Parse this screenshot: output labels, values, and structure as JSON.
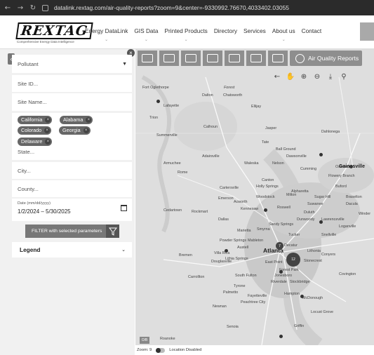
{
  "browser": {
    "url": "datalink.rextag.com/air-quality-reports?zoom=9&center=-9330992.76670,4033402.03055"
  },
  "brand": {
    "name": "REXTAG",
    "tagline": "Comprehensive Energy Data Intelligence"
  },
  "nav": [
    "Energy DataLink",
    "GIS Data",
    "Printed Products",
    "Directory",
    "Services",
    "About us",
    "Contact"
  ],
  "sidebar": {
    "pollutant_label": "Pollutant",
    "site_id_placeholder": "Site ID...",
    "site_name_placeholder": "Site Name...",
    "states": [
      "California",
      "Alabama",
      "Colorado",
      "Georgia",
      "Delaware"
    ],
    "state_placeholder": "State...",
    "city_placeholder": "City...",
    "county_placeholder": "County...",
    "date_label": "Date (mm/dd/yyyy)",
    "date_value": "1/2/2024 – 5/30/2025",
    "filter_label": "FILTER with selected parameters",
    "legend_label": "Legend"
  },
  "map": {
    "report_button": "Air Quality Reports",
    "zoom_text": "Zoom: 9",
    "location_text": "Location Disabled",
    "osm_label": "O/B",
    "clusters": [
      "7",
      "12"
    ],
    "places_major": [
      "Atlanta",
      "Gainesville"
    ],
    "places": [
      "Dalton",
      "Chatsworth",
      "Lafayette",
      "Calhoun",
      "Adairsville",
      "Rome",
      "Cartersville",
      "Cedartown",
      "Rockmart",
      "Dallas",
      "Marietta",
      "Smyrna",
      "Canton",
      "Kennesaw",
      "Woodstock",
      "Holly Springs",
      "Roswell",
      "Alpharetta",
      "Cumming",
      "Sandy Springs",
      "Dunwoody",
      "Buford",
      "Lawrenceville",
      "Dacula",
      "Winder",
      "Decatur",
      "Tucker",
      "East Point",
      "Forest Park",
      "Stockbridge",
      "McDonough",
      "Fayetteville",
      "Peachtree City",
      "Newnan",
      "Carrollton",
      "Bremen",
      "Villa Rica",
      "Griffin",
      "Jonesboro",
      "Covington",
      "Conyers",
      "Stonecrest",
      "Lithonia",
      "Snellville",
      "Loganville",
      "Braselton",
      "Dahlonega",
      "Jasper",
      "Ellijay",
      "Fort Oglethorpe",
      "Acworth",
      "Dawsonville",
      "Flowery Branch",
      "Oakwood",
      "Sugar Hill",
      "Suwanee",
      "Duluth",
      "Milton",
      "South Fulton",
      "Riverdale",
      "Hampton",
      "Locust Grove",
      "Senoia",
      "Palmetto",
      "Tyrone",
      "Powder Springs",
      "Douglasville",
      "Lithia Springs",
      "Austell",
      "Mableton",
      "Tate",
      "Ball Ground",
      "Nelson",
      "Waleska",
      "Emerson",
      "Trion",
      "Summerville",
      "Armuchee",
      "Roanoke"
    ],
    "forest_label": "Forest"
  }
}
